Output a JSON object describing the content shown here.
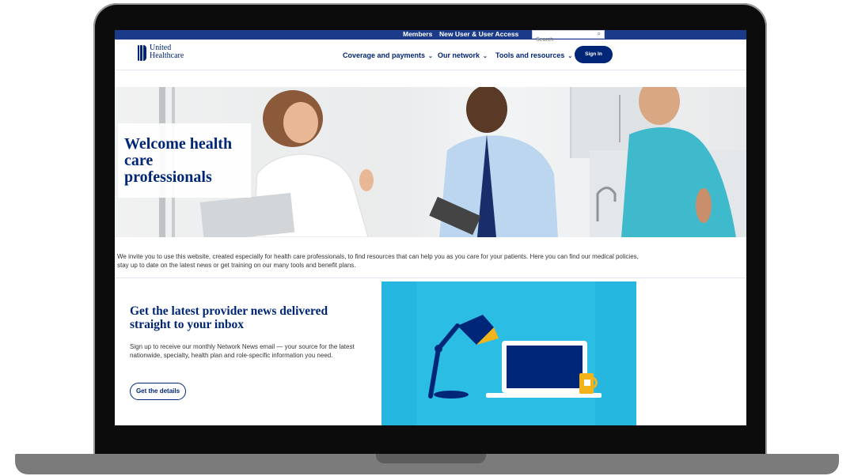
{
  "utility_bar": {
    "members_label": "Members",
    "new_user_label": "New User & User Access",
    "search_placeholder": "Search"
  },
  "header": {
    "logo_line1": "United",
    "logo_line2": "Healthcare",
    "nav": [
      {
        "label": "Coverage and payments"
      },
      {
        "label": "Our network"
      },
      {
        "label": "Tools and resources"
      }
    ],
    "sign_in_label": "Sign In"
  },
  "hero": {
    "title": "Welcome health care professionals"
  },
  "intro": {
    "text": "We invite you to use this website, created especially for health care professionals, to find resources that can help you as you care for your patients. Here you can find our medical policies, stay up to date on the latest news or get training on our many tools and benefit plans."
  },
  "news_card": {
    "title": "Get the latest provider news delivered straight to your inbox",
    "body": "Sign up to receive our monthly Network News email — your source for the latest nationwide, specialty, health plan and role-specific information you need.",
    "button_label": "Get the details"
  },
  "colors": {
    "brand_navy": "#002677",
    "utility_blue": "#1b3a8a",
    "illustration_blue": "#26b7e0",
    "mug_yellow": "#f2b31b"
  }
}
